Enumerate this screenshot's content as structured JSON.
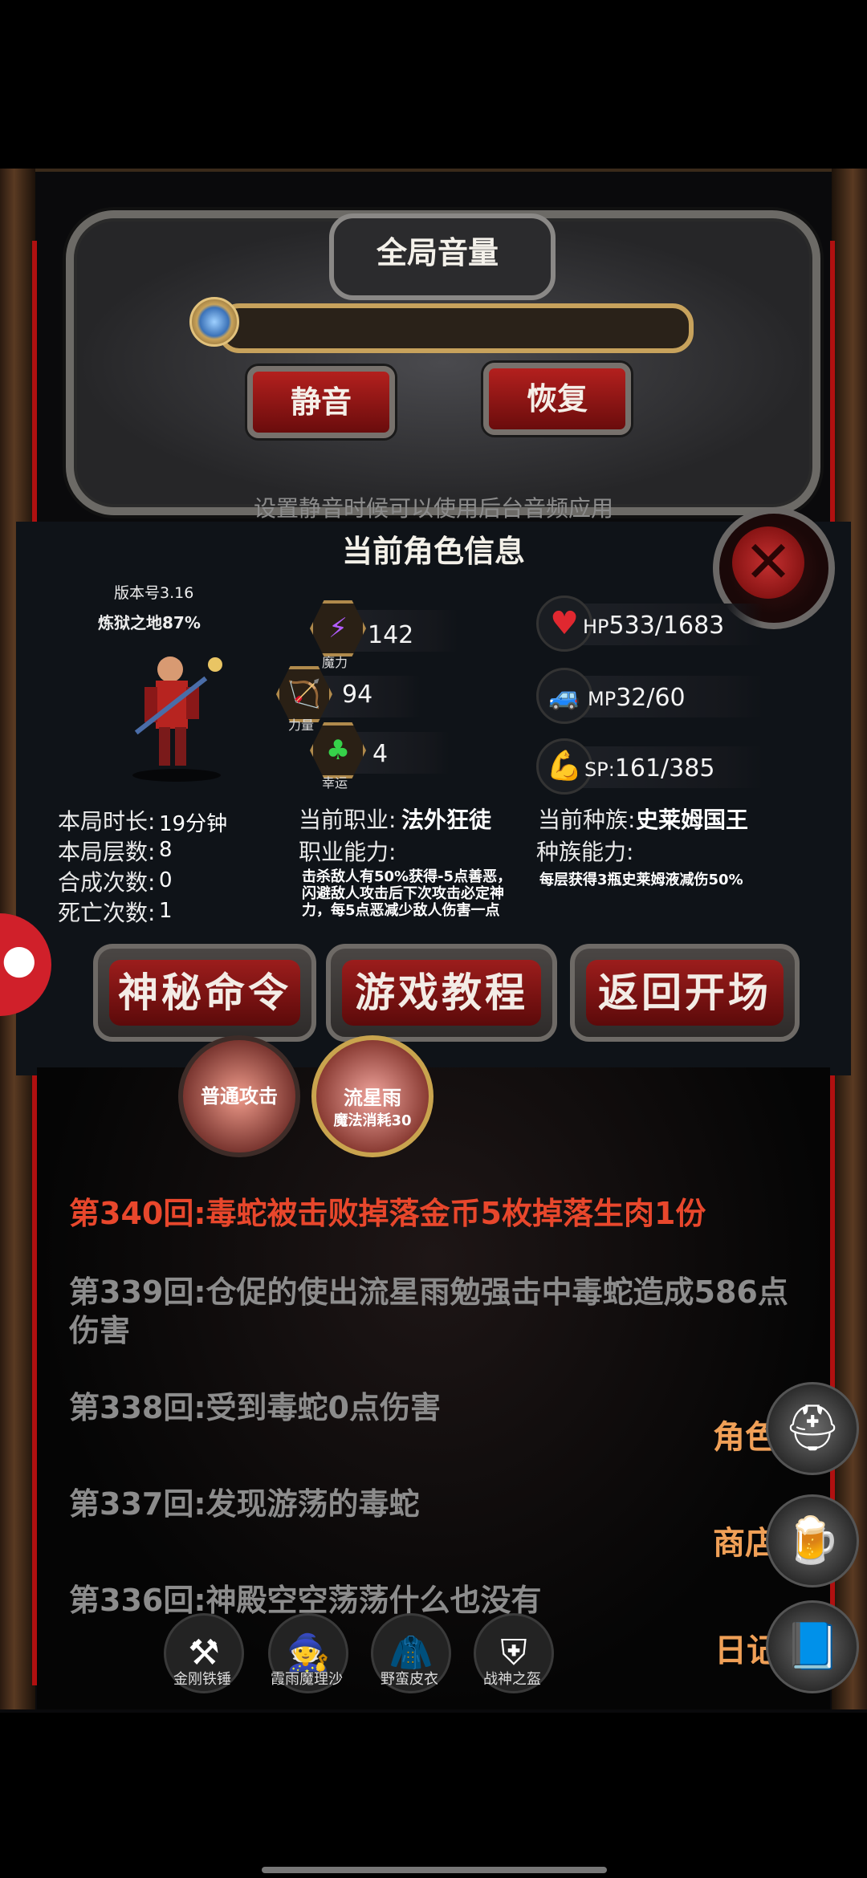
{
  "volume": {
    "title": "全局音量",
    "mute_label": "静音",
    "restore_label": "恢复",
    "hint": "设置静音时候可以使用后台音频应用"
  },
  "info": {
    "title": "当前角色信息",
    "version": "版本号3.16",
    "location": "炼狱之地87%",
    "stats": [
      {
        "caption": "魔力",
        "value": "142"
      },
      {
        "caption": "力量",
        "value": "94"
      },
      {
        "caption": "幸运",
        "value": "4"
      }
    ],
    "hp": {
      "label": "HP",
      "value": "533/1683"
    },
    "mp": {
      "label": "MP",
      "value": "32/60"
    },
    "sp": {
      "label": "SP:",
      "value": "161/385"
    },
    "duration_label": "本局时长:",
    "duration_value": "19分钟",
    "floors_label": "本局层数:",
    "floors_value": "8",
    "crafts_label": "合成次数:",
    "crafts_value": "0",
    "deaths_label": "死亡次数:",
    "deaths_value": "1",
    "job_label": "当前职业:",
    "job_value": "法外狂徒",
    "job_ability_label": "职业能力:",
    "job_ability_desc": "击杀敌人有50%获得-5点善恶，闪避敌人攻击后下次攻击必定神力，每5点恶减少敌人伤害一点",
    "race_label": "当前种族:",
    "race_value": "史莱姆国王",
    "race_ability_label": "种族能力:",
    "race_ability_desc": "每层获得3瓶史莱姆液减伤50%"
  },
  "buttons": {
    "mystery": "神秘命令",
    "tutorial": "游戏教程",
    "back": "返回开场"
  },
  "skills": [
    {
      "label": "普通攻击",
      "sub": ""
    },
    {
      "label": "流星雨",
      "sub": "魔法消耗30"
    }
  ],
  "log": [
    {
      "text": "第340回:毒蛇被击败掉落金币5枚掉落生肉1份",
      "color": "#e8472c"
    },
    {
      "text": "第339回:仓促的使出流星雨勉强击中毒蛇造成586点伤害",
      "color": "#8c8c8c"
    },
    {
      "text": "第338回:受到毒蛇0点伤害",
      "color": "#8c8c8c"
    },
    {
      "text": "第337回:发现游荡的毒蛇",
      "color": "#8c8c8c"
    },
    {
      "text": "第336回:神殿空空荡荡什么也没有",
      "color": "#8c8c8c"
    }
  ],
  "side_menu": [
    {
      "label": "角色",
      "icon": "helmet-icon"
    },
    {
      "label": "商店",
      "icon": "beer-mug-icon"
    },
    {
      "label": "日记",
      "icon": "book-icon"
    }
  ],
  "equipment": [
    {
      "label": "金刚铁锤",
      "icon": "hammer-icon"
    },
    {
      "label": "霞雨魔理沙",
      "icon": "witch-icon"
    },
    {
      "label": "野蛮皮衣",
      "icon": "leopard-coat-icon"
    },
    {
      "label": "战神之盔",
      "icon": "spartan-helmet-icon"
    }
  ]
}
